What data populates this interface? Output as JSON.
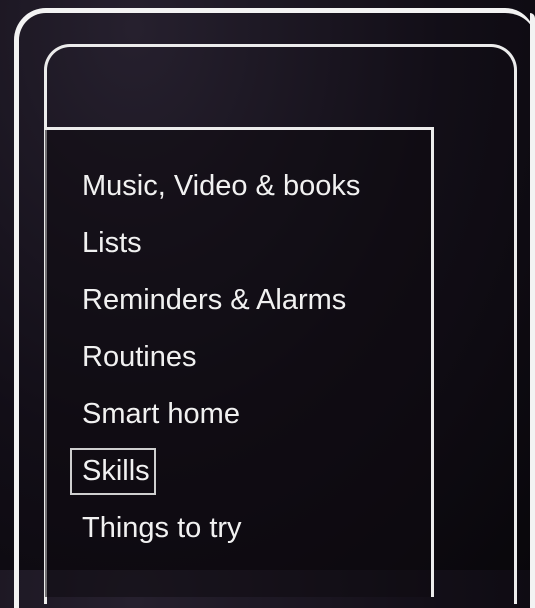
{
  "menu": {
    "items": [
      {
        "label": "Music, Video & books",
        "focused": false
      },
      {
        "label": "Lists",
        "focused": false
      },
      {
        "label": "Reminders & Alarms",
        "focused": false
      },
      {
        "label": "Routines",
        "focused": false
      },
      {
        "label": "Smart home",
        "focused": false
      },
      {
        "label": "Skills",
        "focused": true
      },
      {
        "label": "Things to try",
        "focused": false
      }
    ]
  },
  "colors": {
    "frame": "#f3f3f3",
    "text": "#f1f1f1",
    "focus_outline": "#cfcfcf",
    "background": "#120e17"
  }
}
